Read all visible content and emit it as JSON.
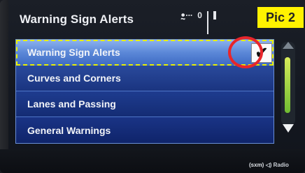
{
  "header": {
    "title": "Warning Sign Alerts",
    "status_bt": "ꔸ∙∙∙",
    "status_zero": "0"
  },
  "badge": {
    "label": "Pic 2"
  },
  "menu": {
    "items": [
      {
        "label": "Warning Sign Alerts",
        "checked": true,
        "selected": true
      },
      {
        "label": "Curves and Corners"
      },
      {
        "label": "Lanes and Passing"
      },
      {
        "label": "General Warnings"
      }
    ],
    "check_mark": "✔"
  },
  "scrollbar": {
    "position_fraction": 0.25
  },
  "footer": {
    "sxm_label": "(sxm)",
    "radio_label": "Radio"
  },
  "colors": {
    "selected_row": "#5c88d8",
    "row_bg": "#1a3480",
    "highlight_dashes": "#e9f000",
    "annotation_circle": "#e8262b",
    "badge_bg": "#fff200",
    "scroll_thumb": "#a6d648"
  }
}
